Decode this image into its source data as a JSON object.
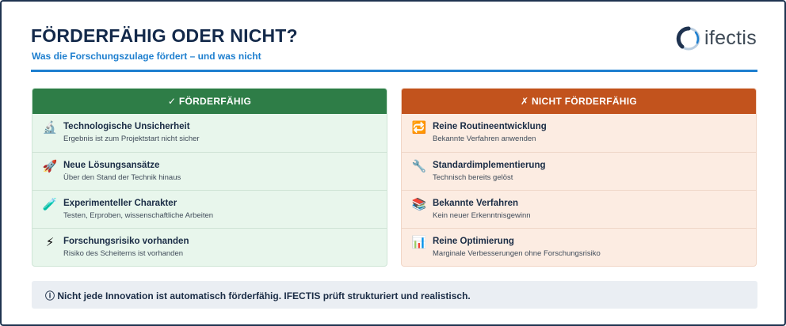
{
  "header": {
    "title": "FÖRDERFÄHIG ODER NICHT?",
    "subtitle": "Was die Forschungszulage fördert – und was nicht",
    "logo_text": "ifectis",
    "accent_color": "#1e7fcf"
  },
  "eligible": {
    "header_label": "✓ FÖRDERFÄHIG",
    "color": "#2e7d47",
    "items": [
      {
        "icon": "microscope-icon",
        "glyph": "🔬",
        "title": "Technologische Unsicherheit",
        "subtitle": "Ergebnis ist zum Projektstart nicht sicher"
      },
      {
        "icon": "rocket-icon",
        "glyph": "🚀",
        "title": "Neue Lösungsansätze",
        "subtitle": "Über den Stand der Technik hinaus"
      },
      {
        "icon": "test-tube-icon",
        "glyph": "🧪",
        "title": "Experimenteller Charakter",
        "subtitle": "Testen, Erproben, wissenschaftliche Arbeiten"
      },
      {
        "icon": "lightning-icon",
        "glyph": "⚡",
        "title": "Forschungsrisiko vorhanden",
        "subtitle": "Risiko des Scheiterns ist vorhanden"
      }
    ]
  },
  "not_eligible": {
    "header_label": "✗ NICHT FÖRDERFÄHIG",
    "color": "#c2531d",
    "items": [
      {
        "icon": "repeat-icon",
        "glyph": "🔁",
        "title": "Reine Routineentwicklung",
        "subtitle": "Bekannte Verfahren anwenden"
      },
      {
        "icon": "wrench-icon",
        "glyph": "🔧",
        "title": "Standardimplementierung",
        "subtitle": "Technisch bereits gelöst"
      },
      {
        "icon": "books-icon",
        "glyph": "📚",
        "title": "Bekannte Verfahren",
        "subtitle": "Kein neuer Erkenntnisgewinn"
      },
      {
        "icon": "bar-chart-icon",
        "glyph": "📊",
        "title": "Reine Optimierung",
        "subtitle": "Marginale Verbesserungen ohne Forschungsrisiko"
      }
    ]
  },
  "note": {
    "text": "ⓘ Nicht jede Innovation ist automatisch förderfähig. IFECTIS prüft strukturiert und realistisch."
  }
}
